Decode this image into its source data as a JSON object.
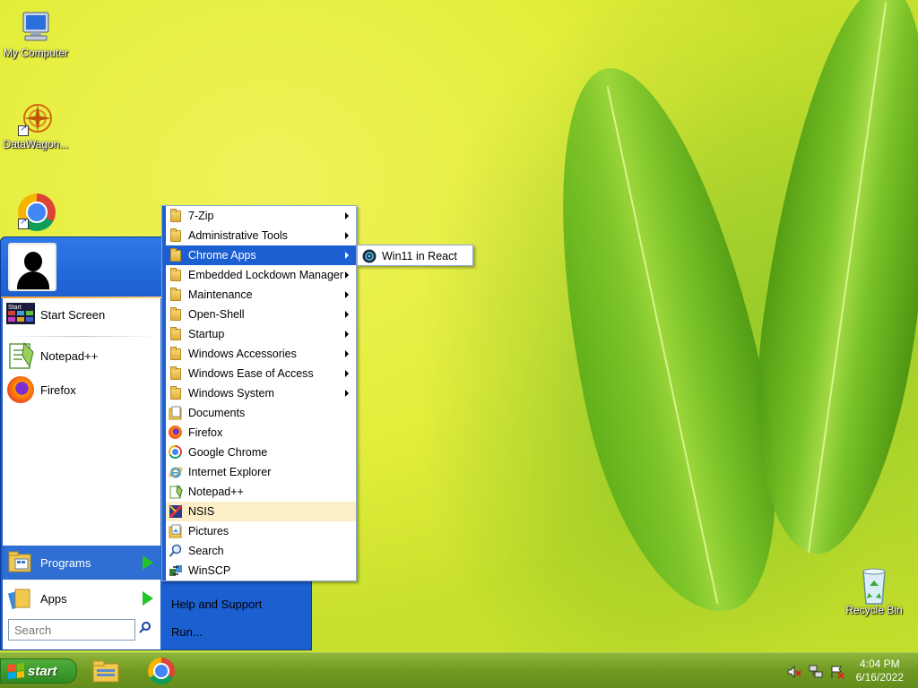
{
  "desktop": {
    "icons": [
      {
        "label": "My Computer"
      },
      {
        "label": "DataWagon..."
      },
      {
        "label": ""
      },
      {
        "label": "Recycle Bin"
      }
    ]
  },
  "start_menu": {
    "pinned": [
      {
        "label": "Start Screen",
        "icon": "start-screen-icon"
      },
      {
        "label": "Notepad++",
        "icon": "notepad-plus-plus-icon"
      },
      {
        "label": "Firefox",
        "icon": "firefox-icon"
      }
    ],
    "programs_label": "Programs",
    "apps_label": "Apps",
    "search_placeholder": "Search",
    "right_links": [
      {
        "label": "Help and Support"
      },
      {
        "label": "Run..."
      }
    ]
  },
  "programs_menu": {
    "items": [
      {
        "label": "7-Zip",
        "type": "folder",
        "submenu": true
      },
      {
        "label": "Administrative Tools",
        "type": "folder",
        "submenu": true
      },
      {
        "label": "Chrome Apps",
        "type": "folder",
        "submenu": true,
        "state": "active"
      },
      {
        "label": "Embedded Lockdown Manager",
        "type": "folder",
        "submenu": true
      },
      {
        "label": "Maintenance",
        "type": "folder",
        "submenu": true
      },
      {
        "label": "Open-Shell",
        "type": "folder",
        "submenu": true
      },
      {
        "label": "Startup",
        "type": "folder",
        "submenu": true
      },
      {
        "label": "Windows Accessories",
        "type": "folder",
        "submenu": true
      },
      {
        "label": "Windows Ease of Access",
        "type": "folder",
        "submenu": true
      },
      {
        "label": "Windows System",
        "type": "folder",
        "submenu": true
      },
      {
        "label": "Documents",
        "type": "documents"
      },
      {
        "label": "Firefox",
        "type": "firefox"
      },
      {
        "label": "Google Chrome",
        "type": "chrome"
      },
      {
        "label": "Internet Explorer",
        "type": "ie"
      },
      {
        "label": "Notepad++",
        "type": "notepad"
      },
      {
        "label": "NSIS",
        "type": "nsis",
        "state": "hover"
      },
      {
        "label": "Pictures",
        "type": "pictures"
      },
      {
        "label": "Search",
        "type": "search"
      },
      {
        "label": "WinSCP",
        "type": "winscp"
      }
    ]
  },
  "chrome_apps_menu": {
    "items": [
      {
        "label": "Win11 in React"
      }
    ]
  },
  "taskbar": {
    "start_label": "start",
    "time": "4:04 PM",
    "date": "6/16/2022"
  },
  "colors": {
    "start_menu_blue": "#1c5fd0",
    "taskbar_green": "#6f9a22",
    "hover_highlight": "#fcefc8"
  }
}
